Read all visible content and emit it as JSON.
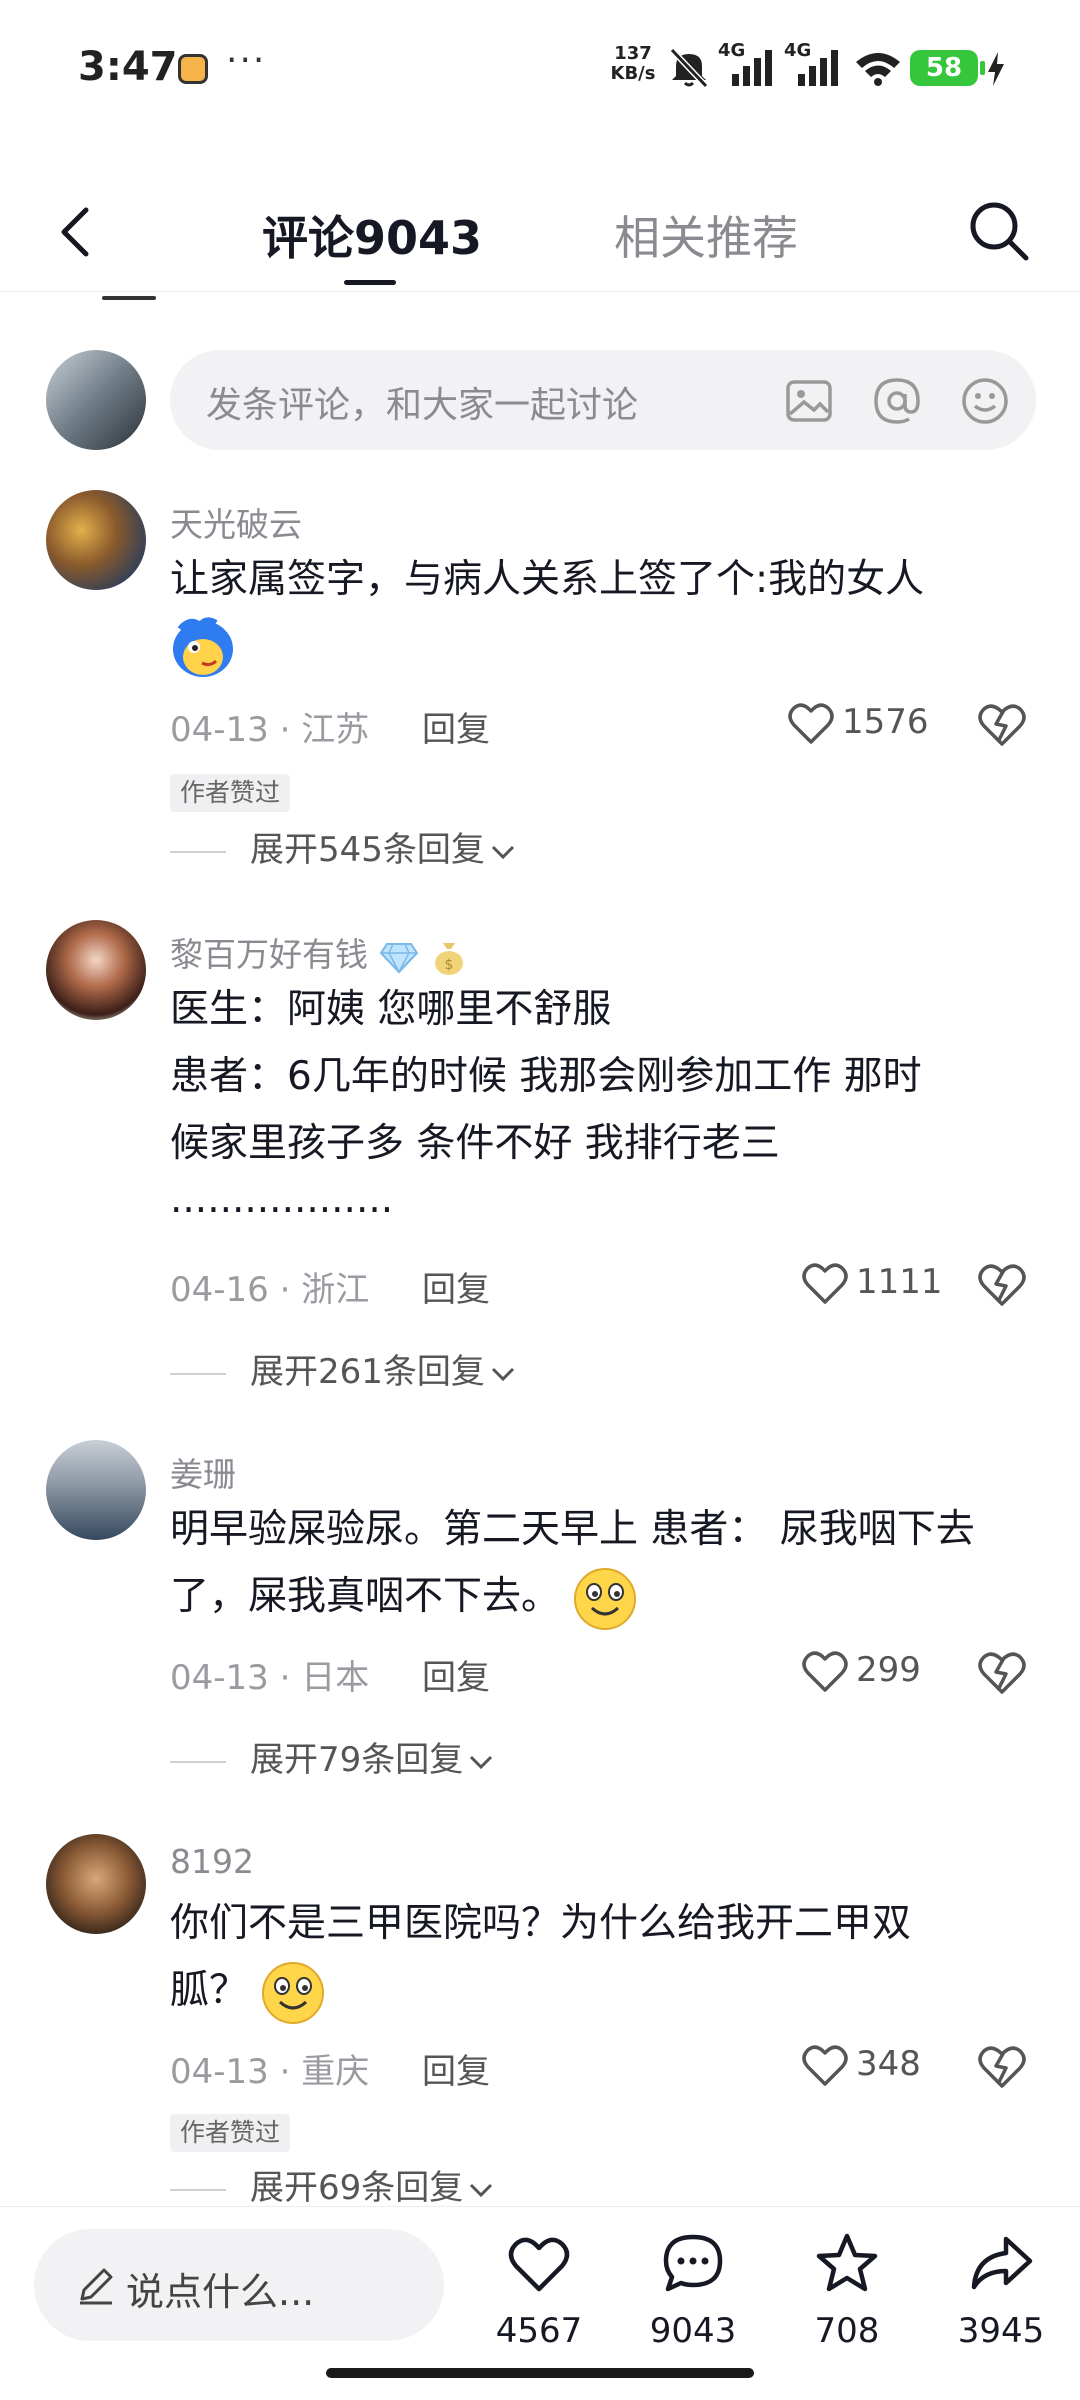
{
  "status_bar": {
    "time": "3:47",
    "dots": "···",
    "net_speed_value": "137",
    "net_speed_unit": "KB/s",
    "sim1": "4G",
    "sim2": "4G",
    "battery": "58",
    "battery_color": "#35c63b"
  },
  "header": {
    "tab_comments": "评论9043",
    "tab_related": "相关推荐"
  },
  "comment_input": {
    "placeholder": "发条评论，和大家一起讨论",
    "icons": [
      "image-icon",
      "at-icon",
      "emoji-icon"
    ]
  },
  "comments": [
    {
      "user": "天光破云",
      "text_lines": [
        "让家属签字，与病人关系上签了个:我的女人"
      ],
      "emoji": "blue-bird-emoji",
      "date": "04-13",
      "location": "江苏",
      "reply": "回复",
      "likes": "1576",
      "badge": "作者赞过",
      "expand": "展开545条回复"
    },
    {
      "user": "黎百万好有钱",
      "user_emojis": [
        "diamond-emoji",
        "money-bag-emoji"
      ],
      "text_lines": [
        "医生：阿姨  您哪里不舒服",
        "患者：6几年的时候  我那会刚参加工作  那时",
        "候家里孩子多  条件不好   我排行老三",
        "··················"
      ],
      "date": "04-16",
      "location": "浙江",
      "reply": "回复",
      "likes": "1111",
      "expand": "展开261条回复"
    },
    {
      "user": "姜珊",
      "text_lines": [
        "明早验屎验尿。第二天早上 患者：  尿我咽下去",
        "了，屎我真咽不下去。"
      ],
      "emoji": "smile-emoji",
      "date": "04-13",
      "location": "日本",
      "reply": "回复",
      "likes": "299",
      "expand": "展开79条回复"
    },
    {
      "user": "8192",
      "text_lines": [
        "你们不是三甲医院吗？为什么给我开二甲双",
        "胍？"
      ],
      "emoji": "smile-emoji",
      "date": "04-13",
      "location": "重庆",
      "reply": "回复",
      "likes": "348",
      "badge": "作者赞过",
      "expand": "展开69条回复"
    }
  ],
  "bottom_bar": {
    "placeholder": "说点什么...",
    "likes": "4567",
    "comments": "9043",
    "favorites": "708",
    "shares": "3945"
  }
}
